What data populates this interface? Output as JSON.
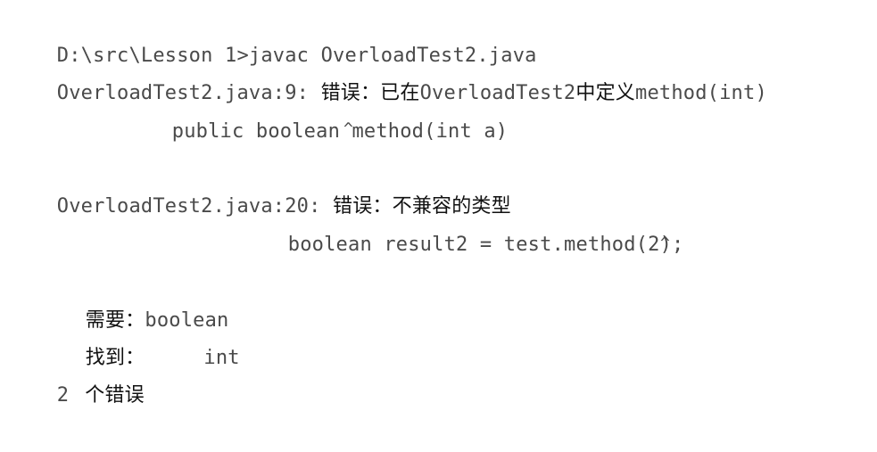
{
  "terminal": {
    "prompt_command": "D:\\src\\Lesson 1>javac OverloadTest2.java",
    "error1": {
      "location": "OverloadTest2.java:9: ",
      "message_prefix": "错误：已在",
      "message_class": "OverloadTest2",
      "message_mid": "中定义",
      "message_method": "method(int)",
      "code_line": "public boolean method(int a)",
      "caret": "^"
    },
    "error2": {
      "location": "OverloadTest2.java:20: ",
      "message": "错误：不兼容的类型",
      "code_line": "boolean result2 = test.method(2);",
      "caret": "^",
      "required_label": "需要：",
      "required_value": "boolean",
      "found_label": "找到：",
      "found_value": "int"
    },
    "summary": {
      "count": "2",
      "text": "个错误"
    }
  }
}
